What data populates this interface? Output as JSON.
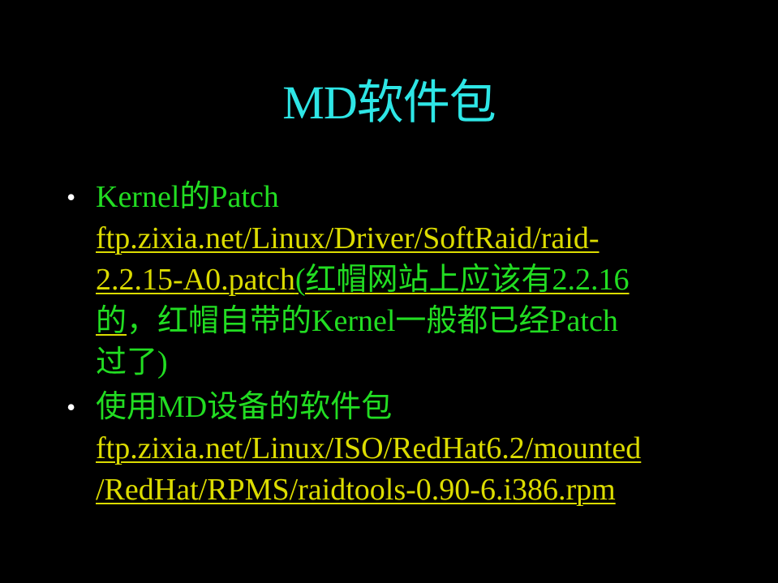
{
  "slide": {
    "title": "MD软件包",
    "bullets": [
      {
        "label": "Kernel的Patch",
        "link_line1": "ftp.zixia.net/Linux/Driver/SoftRaid/raid-",
        "link_line2": "2.2.15-A0.patch",
        "note_line2": "(红帽网站上应该有2.2.16",
        "note_line3_link": "的",
        "note_line3": "，红帽自带的Kernel一般都已经Patch",
        "note_line4": "过了)"
      },
      {
        "label": "使用MD设备的软件包",
        "link_line1": "ftp.zixia.net/Linux/ISO/RedHat6.2/mounted",
        "link_line2": "/RedHat/RPMS/raidtools-0.90-6.i386.rpm"
      }
    ],
    "bullet_symbol": "•",
    "colors": {
      "background": "#000000",
      "title": "#2ee6e6",
      "body_text": "#22dd22",
      "link": "#dcdc00",
      "bullet": "#ffffff"
    }
  }
}
